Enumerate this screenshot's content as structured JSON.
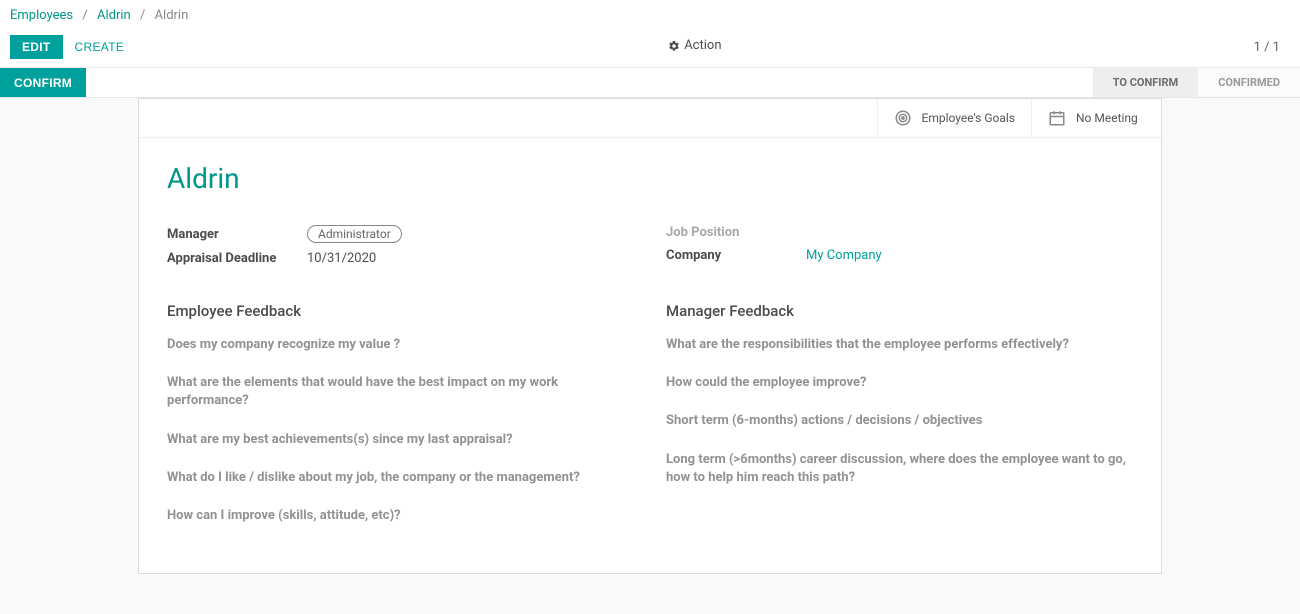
{
  "breadcrumb": {
    "root": "Employees",
    "mid": "Aldrin",
    "current": "Aldrin"
  },
  "controls": {
    "edit": "EDIT",
    "create": "CREATE",
    "action": "Action",
    "pager": "1 / 1"
  },
  "status": {
    "confirm": "CONFIRM",
    "stages": [
      "TO CONFIRM",
      "CONFIRMED"
    ],
    "active_index": 0
  },
  "stat_buttons": {
    "goals": "Employee's Goals",
    "meeting": "No Meeting"
  },
  "record": {
    "title": "Aldrin",
    "left": {
      "manager_label": "Manager",
      "manager_value": "Administrator",
      "deadline_label": "Appraisal Deadline",
      "deadline_value": "10/31/2020"
    },
    "right": {
      "position_label": "Job Position",
      "position_value": "",
      "company_label": "Company",
      "company_value": "My Company"
    }
  },
  "feedback": {
    "employee_title": "Employee Feedback",
    "employee_questions": [
      "Does my company recognize my value ?",
      "What are the elements that would have the best impact on my work performance?",
      "What are my best achievements(s) since my last appraisal?",
      "What do I like / dislike about my job, the company or the management?",
      "How can I improve (skills, attitude, etc)?"
    ],
    "manager_title": "Manager Feedback",
    "manager_questions": [
      "What are the responsibilities that the employee performs effectively?",
      "How could the employee improve?",
      "Short term (6-months) actions / decisions / objectives",
      "Long term (>6months) career discussion, where does the employee want to go, how to help him reach this path?"
    ]
  }
}
